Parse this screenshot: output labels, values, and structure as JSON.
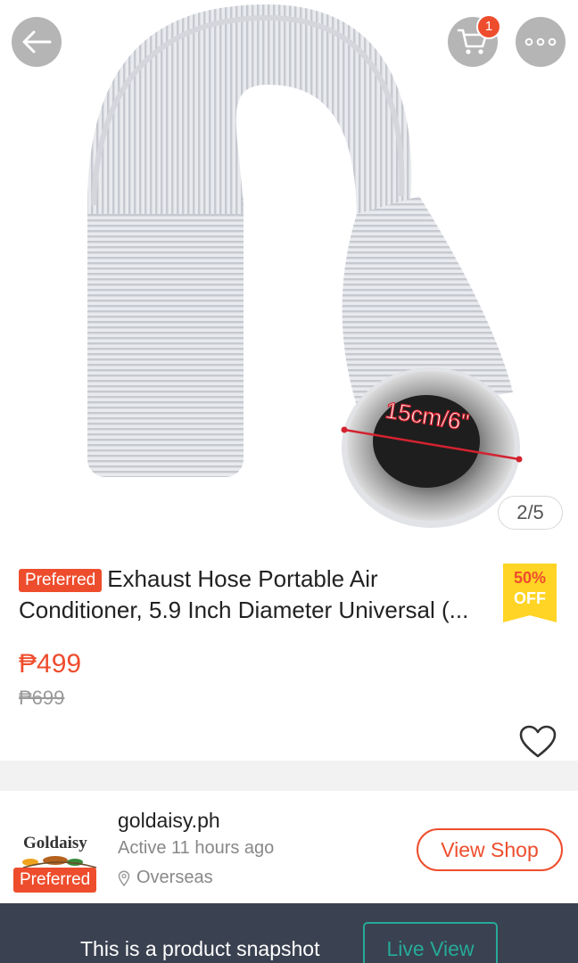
{
  "header": {
    "back_icon": "arrow-left-icon",
    "cart_icon": "cart-icon",
    "cart_count": "1",
    "more_icon": "more-dots-icon"
  },
  "gallery": {
    "diameter_label": "15cm/6\"",
    "indicator": "2/5"
  },
  "product": {
    "tag": "Preferred",
    "title": "Exhaust Hose Portable Air Conditioner, 5.9 Inch Diameter Universal (...",
    "discount_pct": "50%",
    "discount_off": "OFF",
    "price": "₱499",
    "original_price": "₱699",
    "favorite_icon": "heart-icon"
  },
  "shop": {
    "logo_text": "Goldaisy",
    "tag": "Preferred",
    "name": "goldaisy.ph",
    "active": "Active 11 hours ago",
    "location": "Overseas",
    "location_icon": "location-pin-icon",
    "view_button": "View Shop"
  },
  "bottom_bar": {
    "text": "This is a product snapshot",
    "live_button": "Live View"
  },
  "colors": {
    "accent": "#ee4d2d",
    "badge_yellow": "#ffd424",
    "teal": "#26aa99",
    "bar_bg": "#3a4150"
  }
}
